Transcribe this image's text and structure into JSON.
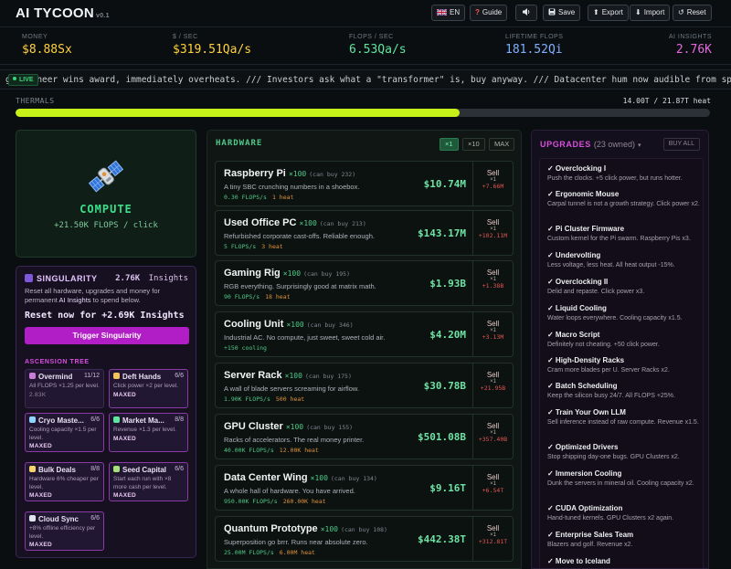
{
  "header": {
    "logo": "AI TYCOON",
    "version": "v0.1",
    "buttons": [
      {
        "icon": "flag-uk-icon",
        "label": "EN"
      },
      {
        "icon": "question-icon",
        "label": "Guide"
      },
      {
        "icon": "speaker-icon",
        "label": ""
      },
      {
        "icon": "save-icon",
        "label": "Save"
      },
      {
        "icon": "export-icon",
        "label": "Export"
      },
      {
        "icon": "import-icon",
        "label": "Import"
      },
      {
        "icon": "reset-icon",
        "label": "Reset"
      }
    ]
  },
  "stats": [
    {
      "label": "MONEY",
      "value": "$8.88Sx",
      "color": "#ffd23d"
    },
    {
      "label": "$ / SEC",
      "value": "$319.51Qa/s",
      "color": "#ffd23d"
    },
    {
      "label": "FLOPS / SEC",
      "value": "6.53Qa/s",
      "color": "#5ee6a0"
    },
    {
      "label": "LIFETIME FLOPS",
      "value": "181.52Qi",
      "color": "#7fb0ff"
    },
    {
      "label": "AI INSIGHTS",
      "value": "2.76K",
      "color": "#e26be0"
    }
  ],
  "ticker": {
    "badge": "LIVE",
    "text": "g engineer wins award, immediately overheats. /// Investors ask what a \"transformer\" is, buy anyway. /// Datacenter hum now audible from space. /// Intern c"
  },
  "thermals": {
    "label": "THERMALS",
    "value": "14.00T / 21.87T heat",
    "fill_fraction": 0.64
  },
  "compute": {
    "icon": "satellite-icon",
    "title": "COMPUTE",
    "subtitle": "+21.50K FLOPS / click"
  },
  "singularity": {
    "title": "SINGULARITY",
    "insights": "2.76K",
    "insights_label": "Insights",
    "desc_pre": "Reset all hardware, upgrades and money for permanent ",
    "desc_em": "AI Insights",
    "desc_post": " to spend below.",
    "reset_text": "Reset now for +2.69K Insights",
    "trigger_label": "Trigger Singularity",
    "tree_label": "ASCENSION TREE",
    "nodes": [
      {
        "name": "Overmind",
        "level": "11/12",
        "desc": "All FLOPS ×1.25 per level.",
        "status": "2.83K",
        "icon_color": "#c77dd8",
        "maxed": false
      },
      {
        "name": "Deft Hands",
        "level": "6/6",
        "desc": "Click power ×2 per level.",
        "status": "MAXED",
        "icon_color": "#f2c35b",
        "maxed": true
      },
      {
        "name": "Cryo Maste...",
        "level": "6/6",
        "desc": "Cooling capacity ×1.5 per level.",
        "status": "MAXED",
        "icon_color": "#8fd3ff",
        "maxed": true
      },
      {
        "name": "Market Ma...",
        "level": "8/8",
        "desc": "Revenue ×1.3 per level.",
        "status": "MAXED",
        "icon_color": "#5ee6a0",
        "maxed": true
      },
      {
        "name": "Bulk Deals",
        "level": "8/8",
        "desc": "Hardware 6% cheaper per level.",
        "status": "MAXED",
        "icon_color": "#f5d56b",
        "maxed": true
      },
      {
        "name": "Seed Capital",
        "level": "6/6",
        "desc": "Start each run with ×8 more cash per level.",
        "status": "MAXED",
        "icon_color": "#a5e07a",
        "maxed": true
      },
      {
        "name": "Cloud Sync",
        "level": "6/6",
        "desc": "+8% offline efficiency per level.",
        "status": "MAXED",
        "icon_color": "#dfe6ee",
        "maxed": true
      }
    ]
  },
  "hardware": {
    "title": "HARDWARE",
    "multipliers": [
      "×1",
      "×10",
      "MAX"
    ],
    "active_multiplier": 0,
    "sell_label": "Sell",
    "sell_qty": "×1",
    "items": [
      {
        "name": "Raspberry Pi",
        "count": "×100",
        "can_buy": "(can buy 232)",
        "desc": "A tiny SBC crunching numbers in a shoebox.",
        "flops": "0.30 FLOPS/s",
        "heat": "1 heat",
        "price": "$10.74M",
        "sell_value": "+7.66M"
      },
      {
        "name": "Used Office PC",
        "count": "×100",
        "can_buy": "(can buy 213)",
        "desc": "Refurbished corporate cast-offs. Reliable enough.",
        "flops": "5 FLOPS/s",
        "heat": "3 heat",
        "price": "$143.17M",
        "sell_value": "+102.11M"
      },
      {
        "name": "Gaming Rig",
        "count": "×100",
        "can_buy": "(can buy 195)",
        "desc": "RGB everything. Surprisingly good at matrix math.",
        "flops": "90 FLOPS/s",
        "heat": "18 heat",
        "price": "$1.93B",
        "sell_value": "+1.38B"
      },
      {
        "name": "Cooling Unit",
        "count": "×100",
        "can_buy": "(can buy 346)",
        "desc": "Industrial AC. No compute, just sweet, sweet cold air.",
        "flops": "+150 cooling",
        "heat": "",
        "price": "$4.20M",
        "sell_value": "+3.13M"
      },
      {
        "name": "Server Rack",
        "count": "×100",
        "can_buy": "(can buy 175)",
        "desc": "A wall of blade servers screaming for airflow.",
        "flops": "1.90K FLOPS/s",
        "heat": "500 heat",
        "price": "$30.78B",
        "sell_value": "+21.95B"
      },
      {
        "name": "GPU Cluster",
        "count": "×100",
        "can_buy": "(can buy 155)",
        "desc": "Racks of accelerators. The real money printer.",
        "flops": "40.00K FLOPS/s",
        "heat": "12.00K heat",
        "price": "$501.08B",
        "sell_value": "+357.40B"
      },
      {
        "name": "Data Center Wing",
        "count": "×100",
        "can_buy": "(can buy 134)",
        "desc": "A whole hall of hardware. You have arrived.",
        "flops": "950.00K FLOPS/s",
        "heat": "260.00K heat",
        "price": "$9.16T",
        "sell_value": "+6.54T"
      },
      {
        "name": "Quantum Prototype",
        "count": "×100",
        "can_buy": "(can buy 108)",
        "desc": "Superposition go brrr. Runs near absolute zero.",
        "flops": "25.00M FLOPS/s",
        "heat": "6.00M heat",
        "price": "$442.38T",
        "sell_value": "+312.81T"
      }
    ]
  },
  "upgrades": {
    "title": "UPGRADES",
    "owned": "(23 owned)",
    "buy_all": "BUY ALL",
    "items": [
      {
        "name": "✓ Overclocking I",
        "desc": "Push the clocks. +5 click power, but runs hotter."
      },
      {
        "name": "✓ Ergonomic Mouse",
        "desc": "Carpal tunnel is not a growth strategy. Click power x2."
      },
      {
        "name": "✓ Pi Cluster Firmware",
        "desc": "Custom kernel for the Pi swarm. Raspberry Pis x3."
      },
      {
        "name": "✓ Undervolting",
        "desc": "Less voltage, less heat. All heat output -15%."
      },
      {
        "name": "✓ Overclocking II",
        "desc": "Delid and repaste. Click power x3."
      },
      {
        "name": "✓ Liquid Cooling",
        "desc": "Water loops everywhere. Cooling capacity x1.5."
      },
      {
        "name": "✓ Macro Script",
        "desc": "Definitely not cheating. +50 click power."
      },
      {
        "name": "✓ High-Density Racks",
        "desc": "Cram more blades per U. Server Racks x2."
      },
      {
        "name": "✓ Batch Scheduling",
        "desc": "Keep the silicon busy 24/7. All FLOPS +25%."
      },
      {
        "name": "✓ Train Your Own LLM",
        "desc": "Sell inference instead of raw compute. Revenue x1.5."
      },
      {
        "name": "✓ Optimized Drivers",
        "desc": "Stop shipping day-one bugs. GPU Clusters x2."
      },
      {
        "name": "✓ Immersion Cooling",
        "desc": "Dunk the servers in mineral oil. Cooling capacity x2."
      },
      {
        "name": "✓ CUDA Optimization",
        "desc": "Hand-tuned kernels. GPU Clusters x2 again."
      },
      {
        "name": "✓ Enterprise Sales Team",
        "desc": "Blazers and golf. Revenue x2."
      },
      {
        "name": "✓ Move to Iceland",
        "desc": ""
      }
    ]
  }
}
